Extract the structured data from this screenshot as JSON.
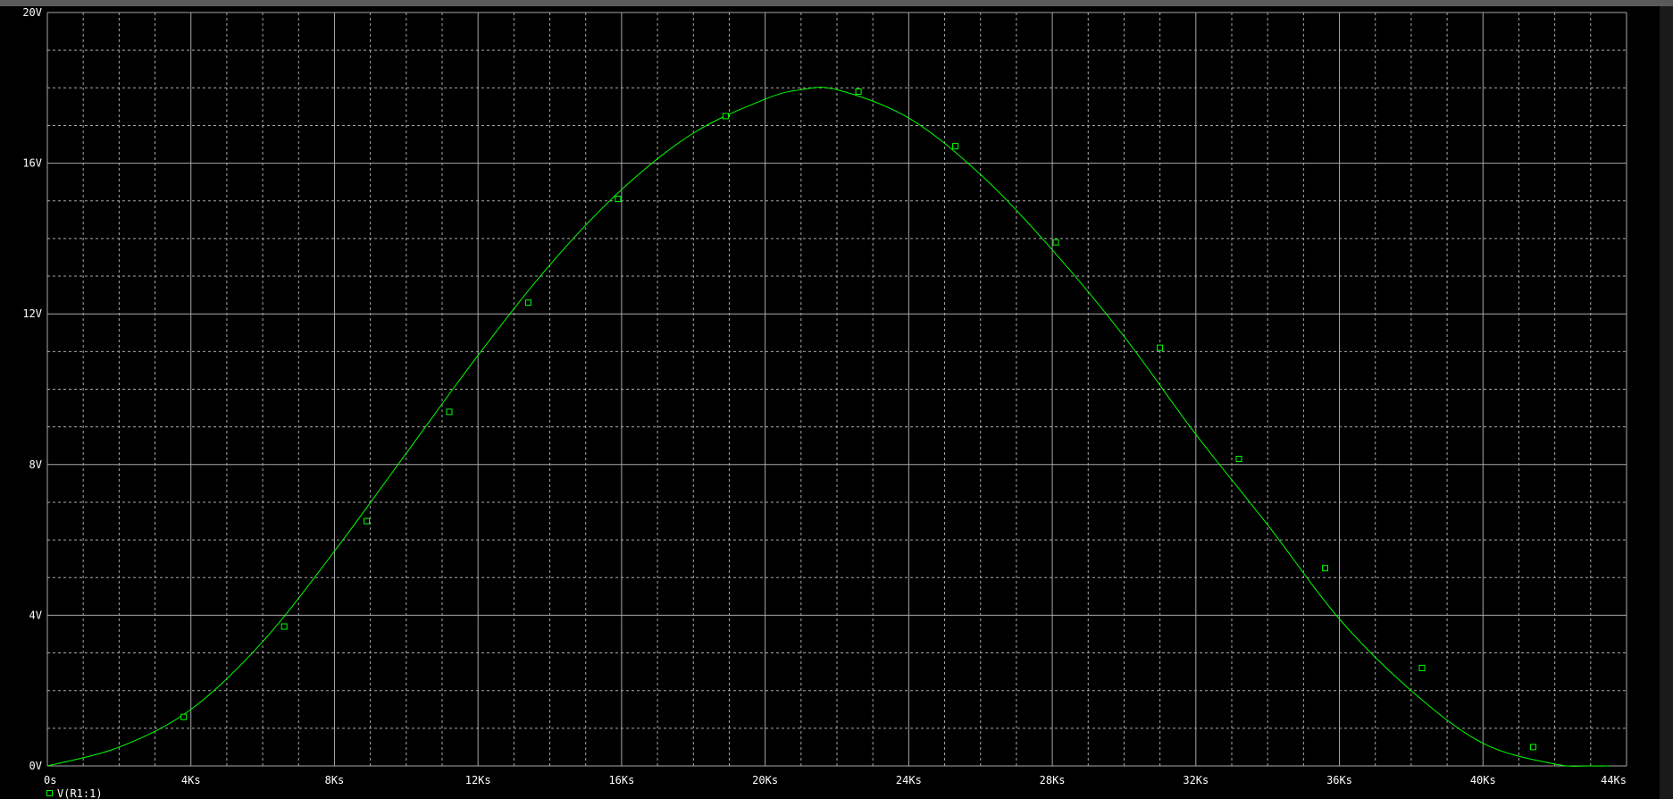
{
  "chart_data": {
    "type": "line",
    "title": "",
    "xlabel": "",
    "ylabel": "",
    "x_ticks": [
      "0s",
      "4Ks",
      "8Ks",
      "12Ks",
      "16Ks",
      "20Ks",
      "24Ks",
      "28Ks",
      "32Ks",
      "36Ks",
      "40Ks",
      "44Ks"
    ],
    "y_ticks": [
      "0V",
      "4V",
      "8V",
      "12V",
      "16V",
      "20V"
    ],
    "xlim": [
      0,
      44000
    ],
    "ylim": [
      0,
      20
    ],
    "grid": true,
    "legend_position": "bottom-left",
    "colors": {
      "background": "#000000",
      "grid": "#a8a8a8",
      "trace": "#00ff00",
      "text": "#ffffff"
    },
    "series": [
      {
        "name": "V(R1:1)",
        "x": [
          0,
          2000,
          4000,
          6000,
          8000,
          10000,
          12000,
          14000,
          16000,
          18000,
          20000,
          21000,
          22000,
          24000,
          26000,
          28000,
          30000,
          32000,
          34000,
          36000,
          38000,
          40000,
          42000,
          43000,
          43500
        ],
        "y": [
          0,
          0.5,
          1.5,
          3.3,
          5.7,
          8.3,
          10.9,
          13.3,
          15.3,
          16.8,
          17.7,
          17.95,
          17.95,
          17.2,
          15.7,
          13.7,
          11.4,
          8.8,
          6.4,
          3.9,
          2.0,
          0.6,
          0.05,
          0.0,
          0.0
        ]
      }
    ],
    "markers": {
      "x": [
        3800,
        6600,
        8900,
        11200,
        13400,
        15900,
        18900,
        22600,
        25300,
        28100,
        31000,
        33200,
        35600,
        38300,
        41400
      ],
      "y": [
        1.3,
        3.7,
        6.5,
        9.4,
        12.3,
        15.05,
        17.25,
        17.9,
        16.45,
        13.9,
        11.1,
        8.15,
        5.25,
        2.6,
        0.5
      ]
    }
  }
}
